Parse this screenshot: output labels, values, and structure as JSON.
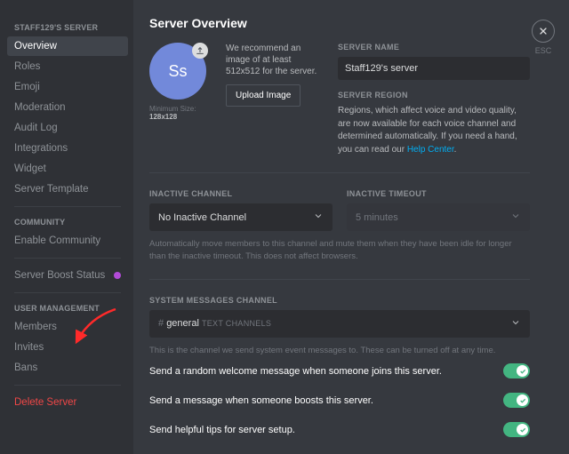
{
  "sidebar": {
    "cat1": "STAFF129'S SERVER",
    "items1": [
      "Overview",
      "Roles",
      "Emoji",
      "Moderation",
      "Audit Log",
      "Integrations",
      "Widget",
      "Server Template"
    ],
    "cat2": "COMMUNITY",
    "items2": [
      "Enable Community"
    ],
    "boost": "Server Boost Status",
    "cat3": "USER MANAGEMENT",
    "items3": [
      "Members",
      "Invites",
      "Bans"
    ],
    "delete": "Delete Server"
  },
  "close": {
    "esc": "ESC"
  },
  "header": {
    "title": "Server Overview"
  },
  "avatar": {
    "initials": "Ss",
    "min_prefix": "Minimum Size: ",
    "min_value": "128x128"
  },
  "recommend": "We recommend an image of at least 512x512 for the server.",
  "upload": "Upload Image",
  "name": {
    "label": "SERVER NAME",
    "value": "Staff129's server"
  },
  "region": {
    "label": "SERVER REGION",
    "text": "Regions, which affect voice and video quality, are now available for each voice channel and determined automatically. If you need a hand, you can read our ",
    "link": "Help Center"
  },
  "inactive": {
    "channel_label": "INACTIVE CHANNEL",
    "channel_value": "No Inactive Channel",
    "timeout_label": "INACTIVE TIMEOUT",
    "timeout_value": "5 minutes",
    "help": "Automatically move members to this channel and mute them when they have been idle for longer than the inactive timeout. This does not affect browsers."
  },
  "system": {
    "label": "SYSTEM MESSAGES CHANNEL",
    "channel_name": "general",
    "channel_cat": "TEXT CHANNELS",
    "help": "This is the channel we send system event messages to. These can be turned off at any time."
  },
  "toggles": {
    "t1": "Send a random welcome message when someone joins this server.",
    "t2": "Send a message when someone boosts this server.",
    "t3": "Send helpful tips for server setup."
  }
}
